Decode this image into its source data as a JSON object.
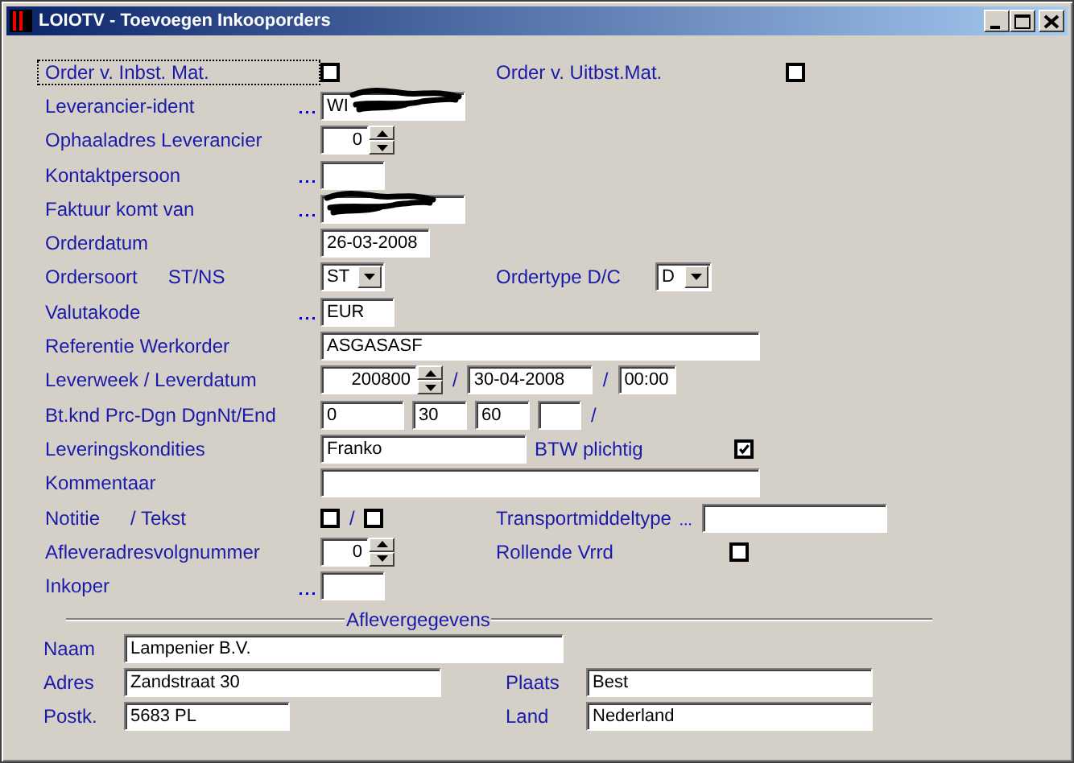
{
  "window": {
    "title": "LOIOTV - Toevoegen Inkooporders"
  },
  "rows": [
    {
      "label": "Order v. Inbst. Mat.",
      "focused": true,
      "lookup": false,
      "controls": [
        {
          "kind": "checkbox",
          "checked": false
        }
      ],
      "right": {
        "label": "Order v. Uitbst.Mat.",
        "lookup": false,
        "controls": [
          {
            "kind": "checkbox",
            "checked": false
          }
        ]
      }
    },
    {
      "label": "Leverancier-ident",
      "focused": false,
      "lookup": true,
      "controls": [
        {
          "kind": "text",
          "value": "WI",
          "redacted": true
        }
      ]
    },
    {
      "label": "Ophaaladres Leverancier",
      "focused": false,
      "lookup": false,
      "controls": [
        {
          "kind": "spinner",
          "value": "0"
        }
      ]
    },
    {
      "label": "Kontaktpersoon",
      "focused": false,
      "lookup": true,
      "controls": [
        {
          "kind": "text",
          "redacted": false
        }
      ]
    },
    {
      "label": "Faktuur komt van",
      "focused": false,
      "lookup": true,
      "controls": [
        {
          "kind": "text",
          "redacted": true
        }
      ]
    },
    {
      "label": "Orderdatum",
      "focused": false,
      "lookup": false,
      "controls": [
        {
          "kind": "text",
          "value": "26-03-2008",
          "redacted": false
        }
      ]
    },
    {
      "label": "Ordersoort",
      "sublabel": "ST/NS",
      "focused": false,
      "lookup": false,
      "controls": [
        {
          "kind": "combo",
          "value": "ST"
        }
      ],
      "right": {
        "label": "Ordertype D/C",
        "lookup": false,
        "controls": [
          {
            "kind": "combo",
            "value": "D"
          }
        ]
      }
    },
    {
      "label": "Valutakode",
      "focused": false,
      "lookup": true,
      "controls": [
        {
          "kind": "text",
          "value": "EUR",
          "redacted": false
        }
      ]
    },
    {
      "label": "Referentie Werkorder",
      "focused": false,
      "lookup": false,
      "controls": [
        {
          "kind": "text",
          "value": "ASGASASF",
          "redacted": false
        }
      ]
    },
    {
      "label": "Leverweek / Leverdatum",
      "focused": false,
      "lookup": false,
      "controls": [
        {
          "kind": "spinner",
          "value": "200800"
        },
        {
          "kind": "sep",
          "text": "/"
        },
        {
          "kind": "text",
          "value": "30-04-2008",
          "redacted": false
        },
        {
          "kind": "sep",
          "text": "/"
        },
        {
          "kind": "text",
          "value": "00:00",
          "redacted": false
        }
      ]
    },
    {
      "label": "Bt.knd Prc-Dgn DgnNt/End",
      "focused": false,
      "lookup": false,
      "controls": [
        {
          "kind": "text",
          "value": "0",
          "redacted": false
        },
        {
          "kind": "text",
          "value": "30",
          "redacted": false
        },
        {
          "kind": "text",
          "value": "60",
          "redacted": false
        },
        {
          "kind": "text",
          "redacted": false
        },
        {
          "kind": "sep",
          "text": "/"
        }
      ]
    },
    {
      "label": "Leveringskondities",
      "focused": false,
      "lookup": false,
      "controls": [
        {
          "kind": "text",
          "value": "Franko",
          "redacted": false
        }
      ],
      "right": {
        "label": "BTW plichtig",
        "lookup": false,
        "controls": [
          {
            "kind": "checkbox",
            "checked": true
          }
        ]
      }
    },
    {
      "label": "Kommentaar",
      "focused": false,
      "lookup": false,
      "controls": [
        {
          "kind": "text",
          "redacted": false
        }
      ]
    },
    {
      "label": "Notitie",
      "sublabel": "/ Tekst",
      "focused": false,
      "lookup": false,
      "controls": [
        {
          "kind": "checkbox",
          "checked": false
        },
        {
          "kind": "sep",
          "text": "/"
        },
        {
          "kind": "checkbox",
          "checked": false
        }
      ],
      "right": {
        "label": "Transportmiddeltype",
        "lookup": true,
        "controls": [
          {
            "kind": "text",
            "redacted": false
          }
        ]
      }
    },
    {
      "label": "Afleveradresvolgnummer",
      "focused": false,
      "lookup": false,
      "controls": [
        {
          "kind": "spinner",
          "value": "0"
        }
      ],
      "right": {
        "label": "Rollende Vrrd",
        "lookup": false,
        "controls": [
          {
            "kind": "checkbox",
            "checked": false
          }
        ]
      }
    },
    {
      "label": "Inkoper",
      "focused": false,
      "lookup": true,
      "controls": [
        {
          "kind": "text",
          "redacted": false
        }
      ]
    }
  ],
  "delivery": {
    "title": "Aflevergegevens",
    "rows": [
      [
        {
          "label": "Naam",
          "value": "Lampenier B.V."
        }
      ],
      [
        {
          "label": "Adres",
          "value": "Zandstraat 30"
        },
        {
          "label": "Plaats",
          "value": "Best"
        }
      ],
      [
        {
          "label": "Postk.",
          "value": "5683 PL"
        },
        {
          "label": "Land",
          "value": "Nederland"
        }
      ]
    ]
  }
}
